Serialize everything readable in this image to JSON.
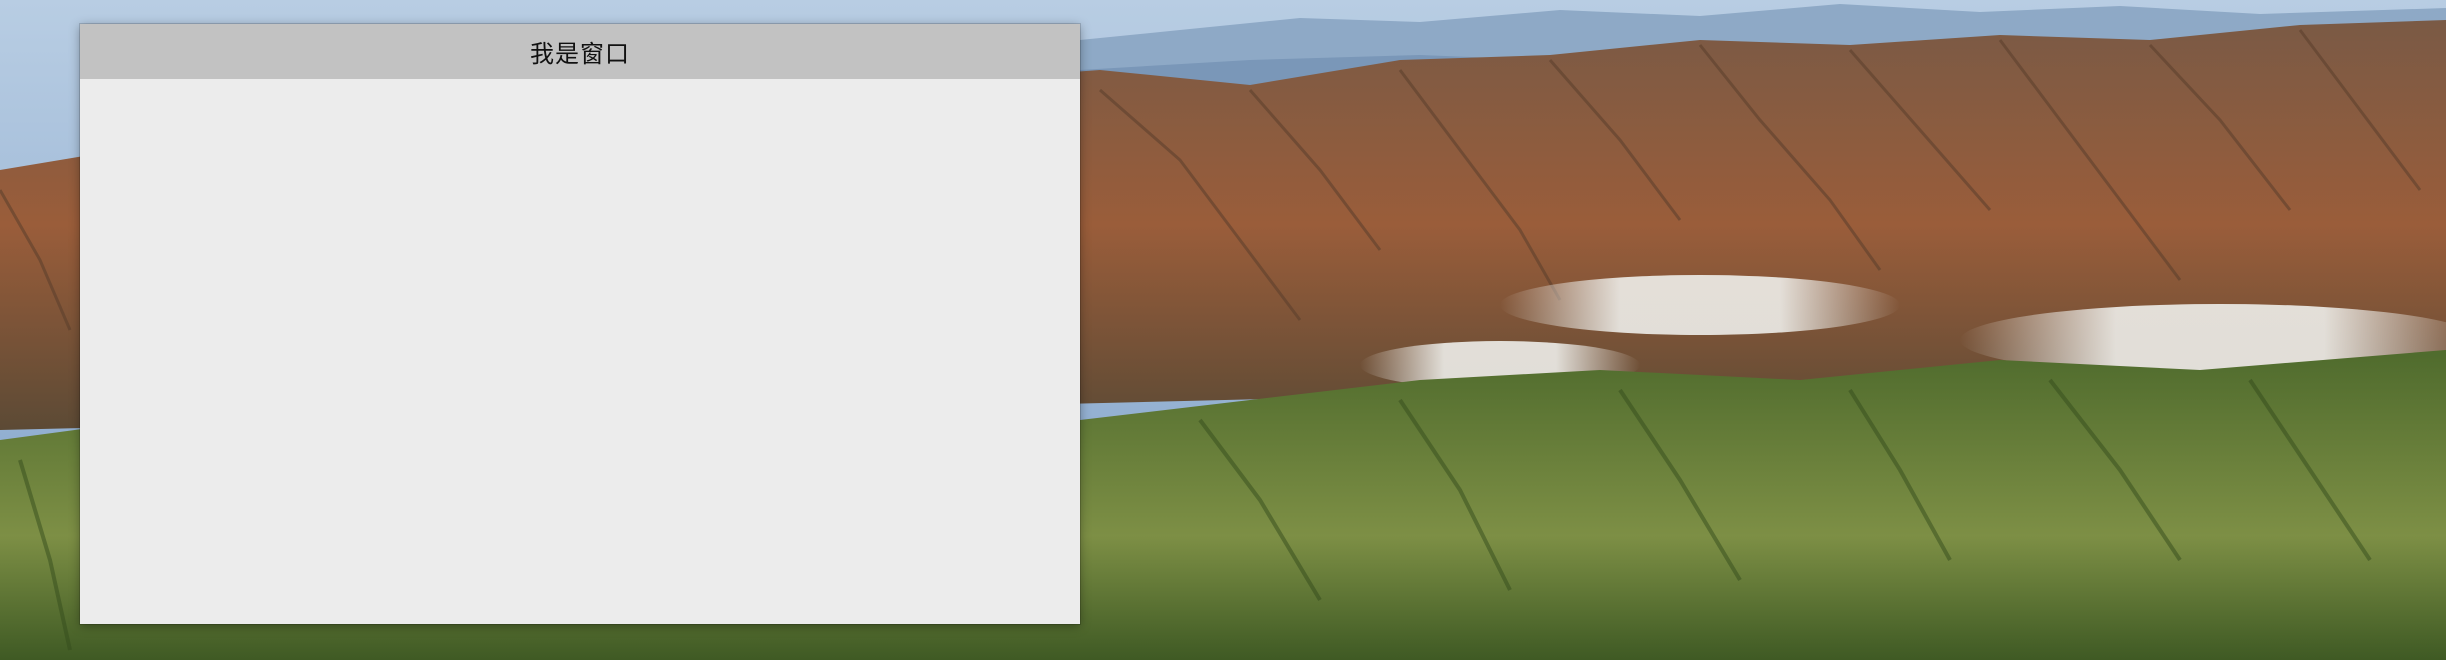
{
  "window": {
    "title": "我是窗口"
  },
  "desktop": {
    "wallpaper": "mountain-landscape",
    "colors": {
      "sky": "#a9c3de",
      "distant_mountains": "#8aa6c4",
      "brown_ridges": "#8d5a3b",
      "green_hills": "#6d8a3d",
      "fog": "#e6e6e2"
    }
  },
  "colors": {
    "titlebar": "#c2c2c2",
    "window_body": "#ececec"
  }
}
